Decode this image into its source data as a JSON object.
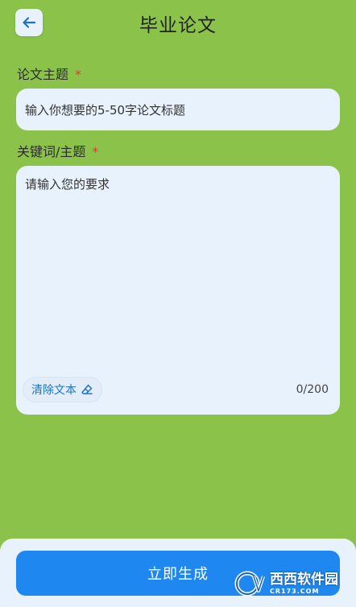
{
  "header": {
    "title": "毕业论文",
    "back_icon": "arrow-left-icon"
  },
  "topic": {
    "label": "论文主题",
    "required_mark": "*",
    "placeholder": "输入你想要的5-50字论文标题"
  },
  "keywords": {
    "label": "关键词/主题",
    "required_mark": "*",
    "placeholder": "请输入您的要求",
    "clear_label": "清除文本",
    "clear_icon": "eraser-icon",
    "counter": "0/200"
  },
  "footer": {
    "generate_label": "立即生成"
  },
  "watermark": {
    "text": "西西软件园",
    "sub": "CR173.COM"
  },
  "colors": {
    "background": "#8bc34a",
    "card": "#e8f2fc",
    "primary": "#1e87f0",
    "required": "#e53935"
  }
}
